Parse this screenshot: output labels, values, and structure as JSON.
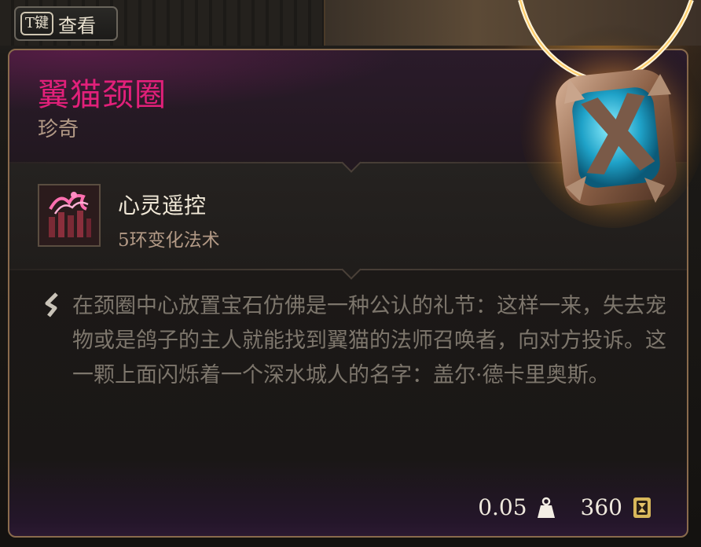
{
  "hint": {
    "key": "T键",
    "label": "查看"
  },
  "item": {
    "name": "翼猫颈圈",
    "rarity": "珍奇",
    "name_color": "#e2207a"
  },
  "spell": {
    "name": "心灵遥控",
    "type": "5环变化法术",
    "icon": "telekinesis-spell-icon"
  },
  "description": "在颈圈中心放置宝石仿佛是一种公认的礼节：这样一来，失去宠物或是鸽子的主人就能找到翼猫的法师召唤者，向对方投诉。这一颗上面闪烁着一个深水城人的名字：盖尔·德卡里奥斯。",
  "footer": {
    "weight": "0.05",
    "value": "360"
  }
}
